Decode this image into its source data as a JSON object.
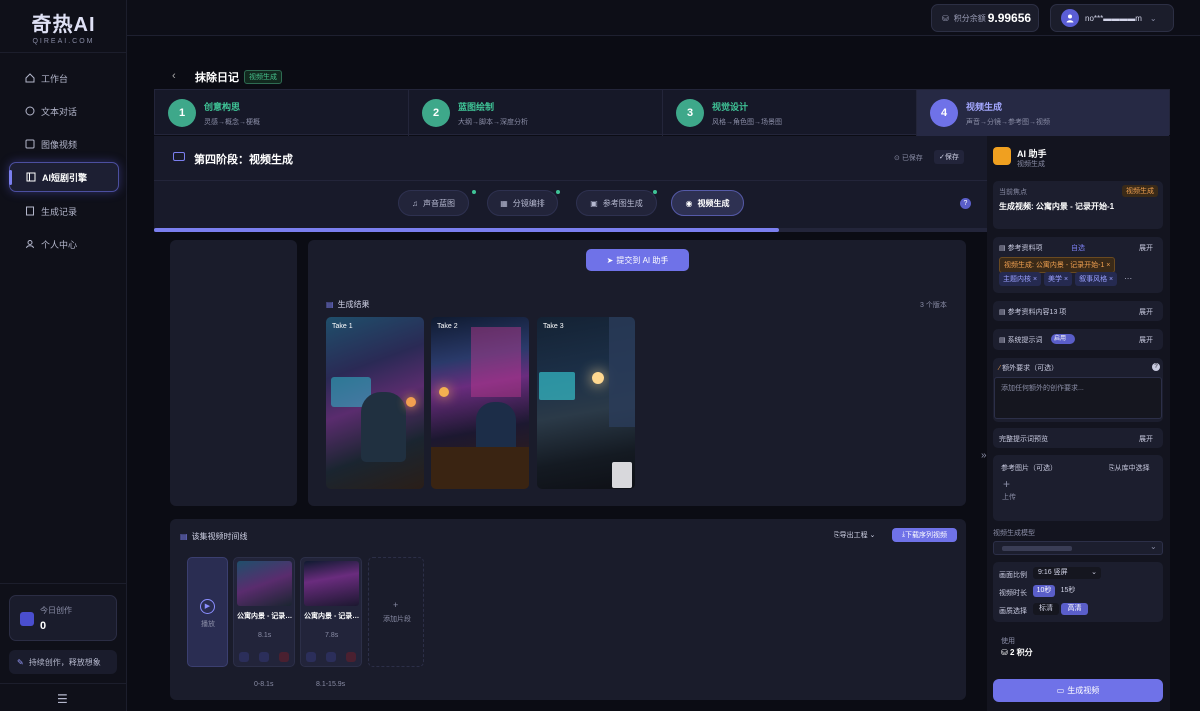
{
  "brand": {
    "name": "奇热AI",
    "sub": "QIREAI.COM"
  },
  "sidebar": {
    "items": [
      {
        "label": "工作台"
      },
      {
        "label": "文本对话"
      },
      {
        "label": "图像视频"
      },
      {
        "label": "AI短剧引擎"
      },
      {
        "label": "生成记录"
      },
      {
        "label": "个人中心"
      }
    ],
    "today_label": "今日创作",
    "today_value": "0",
    "tagline": "持续创作，释放想象"
  },
  "topbar": {
    "credits_label": "积分余额",
    "credits_value": "9.99656",
    "user": "no***▬▬▬▬m"
  },
  "page": {
    "title": "抹除日记",
    "tag": "视频生成"
  },
  "steps": [
    {
      "num": "1",
      "title": "创意构思",
      "desc": "灵感→概念→梗概"
    },
    {
      "num": "2",
      "title": "蓝图绘制",
      "desc": "大纲→脚本→深度分析"
    },
    {
      "num": "3",
      "title": "视觉设计",
      "desc": "风格→角色图→场景图"
    },
    {
      "num": "4",
      "title": "视频生成",
      "desc": "声音→分镜→参考图→视频"
    }
  ],
  "stage": {
    "title": "第四阶段：视频生成",
    "saved": "已保存",
    "save": "保存"
  },
  "tabs": [
    {
      "label": "声音蓝图"
    },
    {
      "label": "分镜编排"
    },
    {
      "label": "参考图生成"
    },
    {
      "label": "视频生成"
    }
  ],
  "progress": 0.75,
  "submit": "提交到 AI 助手",
  "results": {
    "title": "生成结果",
    "count": "3 个版本",
    "takes": [
      "Take 1",
      "Take 2",
      "Take 3"
    ]
  },
  "timeline": {
    "title": "该集视频时间线",
    "export": "导出工程",
    "download": "下载序列视频",
    "play": "播放",
    "add": "添加片段",
    "clips": [
      {
        "title": "公寓内景 - 记录…",
        "dur": "8.1s",
        "range": "0-8.1s"
      },
      {
        "title": "公寓内景 - 记录…",
        "dur": "7.8s",
        "range": "8.1-15.9s"
      }
    ]
  },
  "assistant": {
    "title": "AI 助手",
    "sub": "视频生成",
    "focus_label": "当前焦点",
    "focus_tag": "视频生成",
    "focus_value": "生成视频: 公寓内景 - 记录开始-1",
    "ref_label": "参考资料项",
    "ref_auto": "自选",
    "expand": "展开",
    "ref_pills": [
      "视频生成: 公寓内景 - 记录开始-1 ×",
      "主题内核 ×",
      "美学 ×",
      "叙事风格 ×"
    ],
    "ref_content": "参考资料内容13 项",
    "sys_prompt": "系统提示词",
    "sys_on": "启用",
    "extra_label": "额外要求（可选）",
    "extra_placeholder": "添加任何额外的创作要求...",
    "full_prompt": "完整提示词预览",
    "ref_img": "参考图片（可选）",
    "from_lib": "从库中选择",
    "upload": "上传",
    "model_label": "视频生成模型",
    "ratio_label": "画面比例",
    "ratio_value": "9:16 竖屏",
    "dur_label": "视频时长",
    "dur_opts": [
      "10秒",
      "15秒"
    ],
    "quality_label": "画质选择",
    "quality_opts": [
      "标清",
      "高清"
    ],
    "use_label": "使用",
    "use_value": "2 积分",
    "generate": "生成视频"
  }
}
